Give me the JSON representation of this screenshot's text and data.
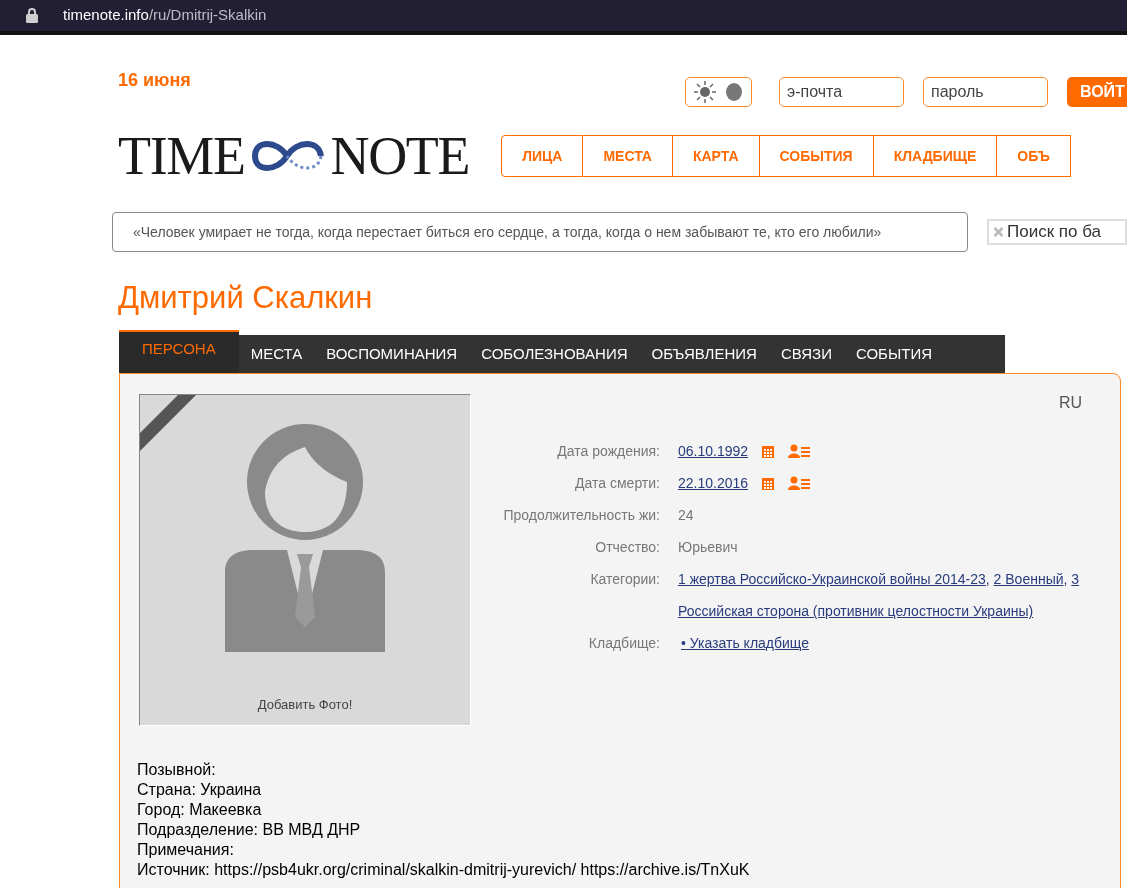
{
  "browser": {
    "url_host": "timenote.info",
    "url_path": "/ru/Dmitrij-Skalkin"
  },
  "header": {
    "date": "16 июня",
    "email_placeholder": "э-почта",
    "password_placeholder": "пароль",
    "login_button": "ВОЙТ"
  },
  "logo": {
    "left": "TIME",
    "right": "NOTE"
  },
  "nav": [
    {
      "label": "ЛИЦА"
    },
    {
      "label": "МЕСТА"
    },
    {
      "label": "КАРТА"
    },
    {
      "label": "СОБЫТИЯ"
    },
    {
      "label": "КЛАДБИЩЕ"
    },
    {
      "label": "ОБЪ"
    }
  ],
  "quote": "«Человек умирает не тогда, когда перестает биться его сердце, а тогда, когда о нем забывают те, кто его любили»",
  "search": {
    "placeholder": "Поиск по ба"
  },
  "person": {
    "name": "Дмитрий Скалкин",
    "tabs": [
      {
        "label": "ПЕРСОНА",
        "selected": true
      },
      {
        "label": "МЕСТА",
        "selected": false
      },
      {
        "label": "ВОСПОМИНАНИЯ",
        "selected": false
      },
      {
        "label": "СОБОЛЕЗНОВАНИЯ",
        "selected": false
      },
      {
        "label": "ОБЪЯВЛЕНИЯ",
        "selected": false
      },
      {
        "label": "СВЯЗИ",
        "selected": false
      },
      {
        "label": "СОБЫТИЯ",
        "selected": false
      }
    ],
    "language": "RU",
    "photo_caption": "Добавить Фото!",
    "fields": [
      {
        "kind": "date",
        "label": "Дата рождения:",
        "value": "06.10.1992"
      },
      {
        "kind": "date",
        "label": "Дата смерти:",
        "value": "22.10.2016"
      },
      {
        "kind": "text",
        "label": "Продолжительность жи:",
        "value": "24"
      },
      {
        "kind": "text",
        "label": "Отчество:",
        "value": "Юрьевич"
      },
      {
        "kind": "links",
        "label": "Категории:",
        "separator": ",",
        "links": [
          "1 жертва Российско-Украинской войны 2014-23",
          "2 Военный",
          "3 Российская сторона (противник целостности Украины)"
        ]
      },
      {
        "kind": "link",
        "label": "Кладбище:",
        "value": "• Указать кладбище"
      }
    ],
    "notes": [
      "Позывной:",
      "Страна: Украина",
      "Город: Макеевка",
      "Подразделение: ВВ МВД ДНР",
      "Примечания:",
      "Источник: https://psb4ukr.org/criminal/skalkin-dmitrij-yurevich/ https://archive.is/TnXuK"
    ]
  }
}
